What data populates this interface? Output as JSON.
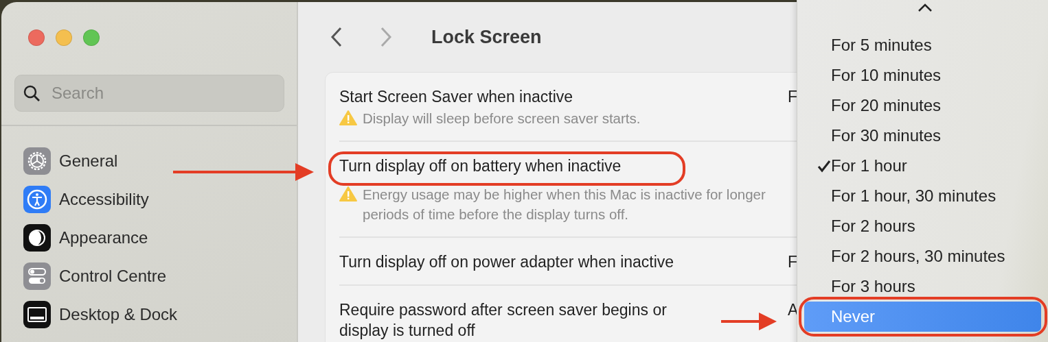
{
  "sidebar": {
    "search": {
      "placeholder": "Search"
    },
    "items": [
      {
        "label": "General",
        "kind": "gear"
      },
      {
        "label": "Accessibility",
        "kind": "accessibility"
      },
      {
        "label": "Appearance",
        "kind": "appearance"
      },
      {
        "label": "Control Centre",
        "kind": "toggles"
      },
      {
        "label": "Desktop & Dock",
        "kind": "dock"
      }
    ]
  },
  "header": {
    "title": "Lock Screen",
    "back_disabled": false,
    "forward_disabled": true
  },
  "settings": [
    {
      "label": "Start Screen Saver when inactive",
      "note": "Display will sleep before screen saver starts.",
      "value": "F",
      "circled": false
    },
    {
      "label": "Turn display off on battery when inactive",
      "note": "Energy usage may be higher when this Mac is inactive for longer periods of time before the display turns off.",
      "circled": true
    },
    {
      "label": "Turn display off on power adapter when inactive",
      "value": "F",
      "circled": false
    },
    {
      "label": "Require password after screen saver begins or display is turned off",
      "value": "A",
      "circled": false
    }
  ],
  "menu": {
    "items": [
      {
        "label": "For 5 minutes",
        "checked": false,
        "selected": false,
        "circled": false
      },
      {
        "label": "For 10 minutes",
        "checked": false,
        "selected": false,
        "circled": false
      },
      {
        "label": "For 20 minutes",
        "checked": false,
        "selected": false,
        "circled": false
      },
      {
        "label": "For 30 minutes",
        "checked": false,
        "selected": false,
        "circled": false
      },
      {
        "label": "For 1 hour",
        "checked": true,
        "selected": false,
        "circled": false
      },
      {
        "label": "For 1 hour, 30 minutes",
        "checked": false,
        "selected": false,
        "circled": false
      },
      {
        "label": "For 2 hours",
        "checked": false,
        "selected": false,
        "circled": false
      },
      {
        "label": "For 2 hours, 30 minutes",
        "checked": false,
        "selected": false,
        "circled": false
      },
      {
        "label": "For 3 hours",
        "checked": false,
        "selected": false,
        "circled": false
      },
      {
        "label": "Never",
        "checked": false,
        "selected": true,
        "circled": true
      }
    ]
  }
}
